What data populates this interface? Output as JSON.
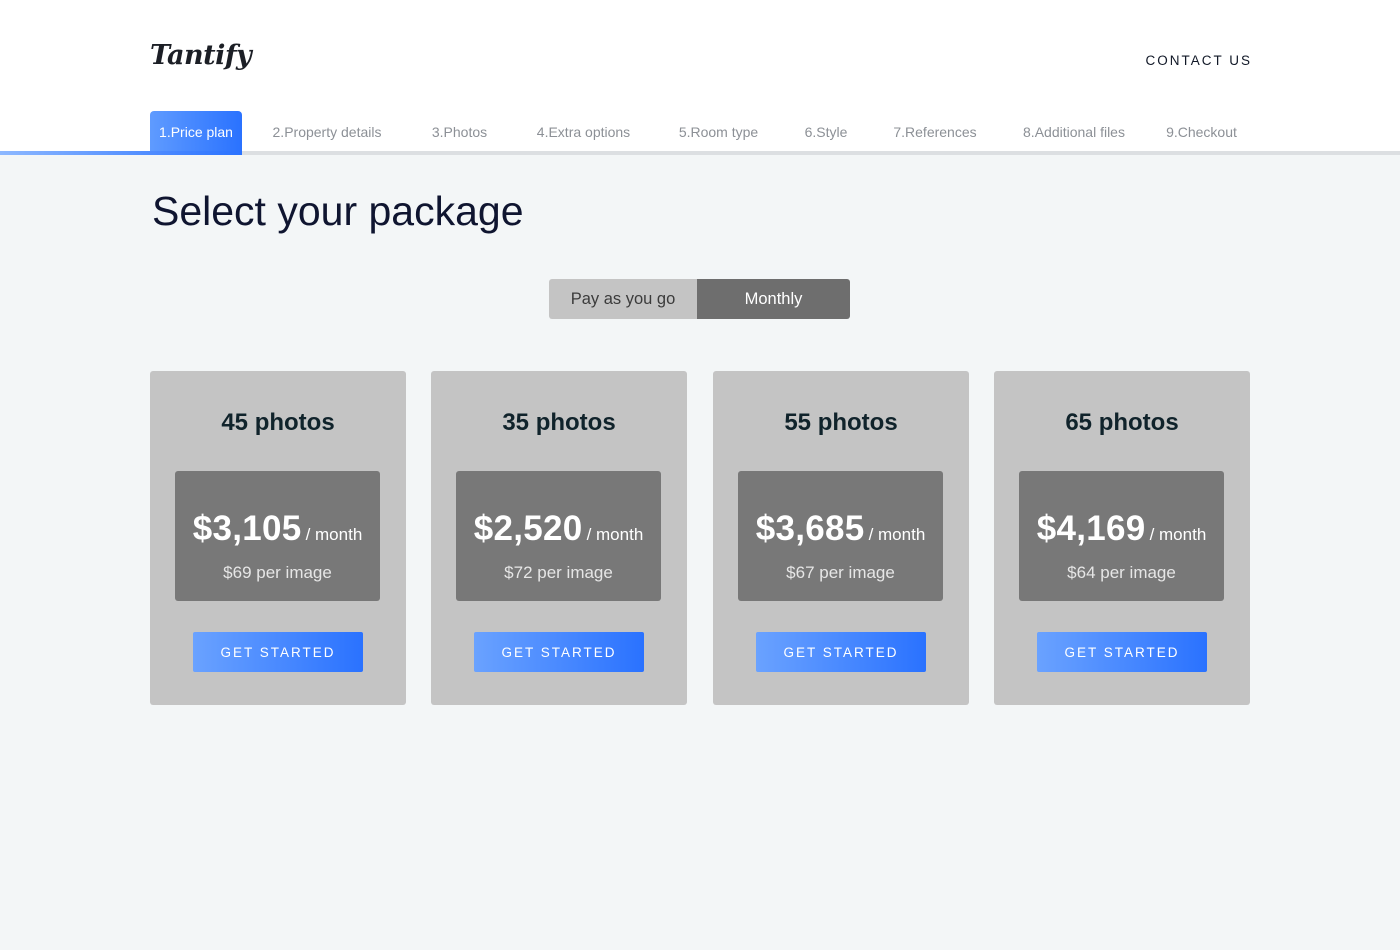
{
  "brand": {
    "logo_text": "Tantify"
  },
  "header": {
    "contact_label": "CONTACT US"
  },
  "steps": [
    {
      "label": "1.Price plan"
    },
    {
      "label": "2.Property details"
    },
    {
      "label": "3.Photos"
    },
    {
      "label": "4.Extra options"
    },
    {
      "label": "5.Room type"
    },
    {
      "label": "6.Style"
    },
    {
      "label": "7.References"
    },
    {
      "label": "8.Additional files"
    },
    {
      "label": "9.Checkout"
    }
  ],
  "active_step": 1,
  "page": {
    "title": "Select your package"
  },
  "billing_toggle": {
    "options": [
      {
        "label": "Pay as you go"
      },
      {
        "label": "Monthly"
      }
    ],
    "selected": "Monthly"
  },
  "packages": [
    {
      "title": "45 photos",
      "price": "$3,105",
      "period": "/ month",
      "per_image": "$69 per image",
      "cta": "GET STARTED"
    },
    {
      "title": "35 photos",
      "price": "$2,520",
      "period": "/ month",
      "per_image": "$72 per image",
      "cta": "GET STARTED"
    },
    {
      "title": "55 photos",
      "price": "$3,685",
      "period": "/ month",
      "per_image": "$67 per image",
      "cta": "GET STARTED"
    },
    {
      "title": "65 photos",
      "price": "$4,169",
      "period": "/ month",
      "per_image": "$64 per image",
      "cta": "GET STARTED"
    }
  ],
  "colors": {
    "accent": "#2a72ff",
    "page_background": "#f3f6f7",
    "card_background": "#c4c4c4",
    "price_box_background": "#787878",
    "title_text": "#0f1530"
  }
}
